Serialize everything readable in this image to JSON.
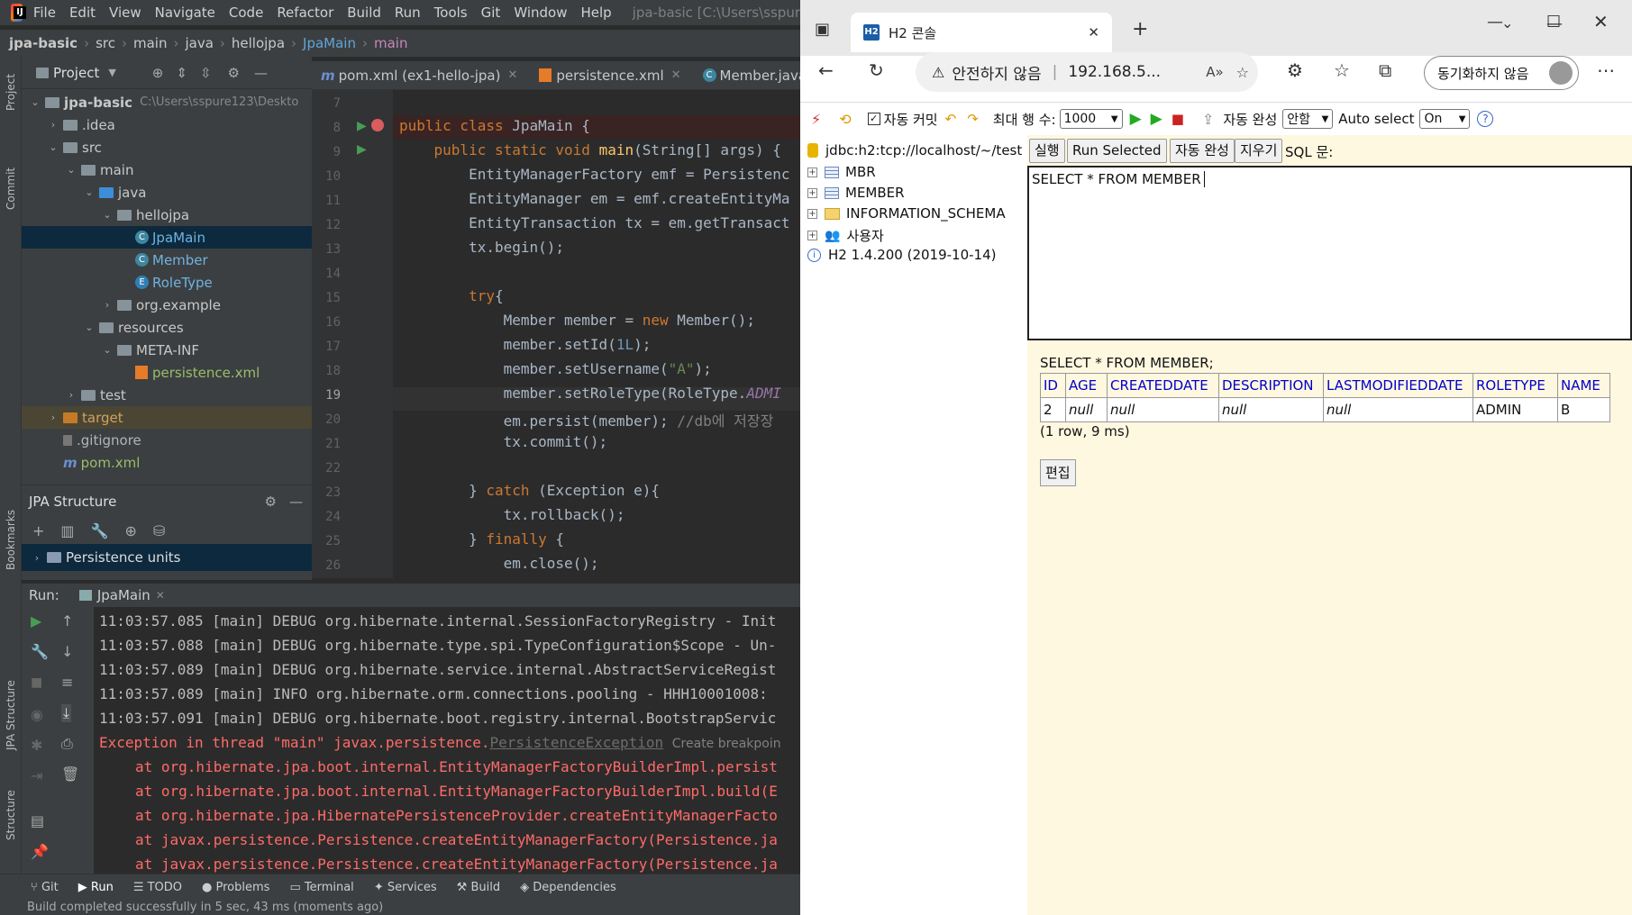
{
  "ide": {
    "menu": [
      "File",
      "Edit",
      "View",
      "Navigate",
      "Code",
      "Refactor",
      "Build",
      "Run",
      "Tools",
      "Git",
      "Window",
      "Help"
    ],
    "title": "jpa-basic [C:\\Users\\sspur",
    "breadcrumb": [
      "jpa-basic",
      "src",
      "main",
      "java",
      "hellojpa",
      "JpaMain",
      "main"
    ],
    "project_label": "Project",
    "tabs": [
      {
        "label": "pom.xml (ex1-hello-jpa)",
        "icon": "maven-icon"
      },
      {
        "label": "persistence.xml",
        "icon": "xml-icon"
      },
      {
        "label": "Member.java",
        "icon": "class-icon"
      }
    ],
    "tree": [
      {
        "label": "jpa-basic",
        "extra": "C:\\Users\\sspure123\\Deskto",
        "depth": 0,
        "arrow": "v",
        "icon": "folder"
      },
      {
        "label": ".idea",
        "depth": 1,
        "arrow": ">",
        "icon": "folder"
      },
      {
        "label": "src",
        "depth": 1,
        "arrow": "v",
        "icon": "folder"
      },
      {
        "label": "main",
        "depth": 2,
        "arrow": "v",
        "icon": "folder"
      },
      {
        "label": "java",
        "depth": 3,
        "arrow": "v",
        "icon": "folder-blue"
      },
      {
        "label": "hellojpa",
        "depth": 4,
        "arrow": "v",
        "icon": "package"
      },
      {
        "label": "JpaMain",
        "depth": 5,
        "arrow": "",
        "icon": "class",
        "selected": true
      },
      {
        "label": "Member",
        "depth": 5,
        "arrow": "",
        "icon": "class"
      },
      {
        "label": "RoleType",
        "depth": 5,
        "arrow": "",
        "icon": "enum"
      },
      {
        "label": "org.example",
        "depth": 4,
        "arrow": ">",
        "icon": "package"
      },
      {
        "label": "resources",
        "depth": 3,
        "arrow": "v",
        "icon": "folder"
      },
      {
        "label": "META-INF",
        "depth": 4,
        "arrow": "v",
        "icon": "folder"
      },
      {
        "label": "persistence.xml",
        "depth": 5,
        "arrow": "",
        "icon": "xml"
      },
      {
        "label": "test",
        "depth": 2,
        "arrow": ">",
        "icon": "folder"
      },
      {
        "label": "target",
        "depth": 1,
        "arrow": ">",
        "icon": "folder-orange",
        "highlight": true
      },
      {
        "label": ".gitignore",
        "depth": 1,
        "arrow": "",
        "icon": "git"
      },
      {
        "label": "pom.xml",
        "depth": 1,
        "arrow": "",
        "icon": "maven"
      }
    ],
    "structure_title": "JPA Structure",
    "structure_item": "Persistence units",
    "line_numbers": [
      "7",
      "8",
      "9",
      "10",
      "11",
      "12",
      "13",
      "14",
      "15",
      "16",
      "17",
      "18",
      "19",
      "20",
      "21",
      "22",
      "23",
      "24",
      "25",
      "26"
    ],
    "run_label": "Run:",
    "run_tab": "JpaMain",
    "log": [
      "11:03:57.085 [main] DEBUG org.hibernate.internal.SessionFactoryRegistry - Init",
      "11:03:57.088 [main] DEBUG org.hibernate.type.spi.TypeConfiguration$Scope - Un-",
      "11:03:57.089 [main] DEBUG org.hibernate.service.internal.AbstractServiceRegist",
      "11:03:57.089 [main] INFO org.hibernate.orm.connections.pooling - HHH10001008:",
      "11:03:57.091 [main] DEBUG org.hibernate.boot.registry.internal.BootstrapServic"
    ],
    "exception_prefix": "Exception in thread \"main\" javax.persistence.",
    "exception_link": "PersistenceException",
    "exception_hint": "Create breakpoin",
    "stack": [
      "at org.hibernate.jpa.boot.internal.EntityManagerFactoryBuilderImpl.persist",
      "at org.hibernate.jpa.boot.internal.EntityManagerFactoryBuilderImpl.build(E",
      "at org.hibernate.jpa.HibernatePersistenceProvider.createEntityManagerFacto",
      "at javax.persistence.Persistence.createEntityManagerFactory(Persistence.ja",
      "at javax.persistence.Persistence.createEntityManagerFactory(Persistence.ja"
    ],
    "bottom_tabs": [
      "Git",
      "Run",
      "TODO",
      "Problems",
      "Terminal",
      "Services",
      "Build",
      "Dependencies"
    ],
    "status": "Build completed successfully in 5 sec, 43 ms (moments ago)",
    "left_strip": [
      "Project",
      "Commit",
      "Bookmarks",
      "JPA Structure",
      "Structure"
    ]
  },
  "browser": {
    "tab_title": "H2 콘솔",
    "security": "안전하지 않음",
    "url": "192.168.5...",
    "sync_label": "동기화하지 않음"
  },
  "h2": {
    "auto_commit": "자동 커밋",
    "max_rows_label": "최대 행 수:",
    "max_rows": "1000",
    "autocomplete_label": "자동 완성",
    "autocomplete_value": "안함",
    "auto_select_label": "Auto select",
    "auto_select_value": "On",
    "connection": "jdbc:h2:tcp://localhost/~/test",
    "tree": [
      "MBR",
      "MEMBER",
      "INFORMATION_SCHEMA",
      "사용자"
    ],
    "version": "H2 1.4.200 (2019-10-14)",
    "buttons": [
      "실행",
      "Run Selected",
      "자동 완성",
      "지우기"
    ],
    "sql_label": "SQL 문:",
    "sql_text": "SELECT * FROM MEMBER",
    "result_query": "SELECT * FROM MEMBER;",
    "columns": [
      "ID",
      "AGE",
      "CREATEDDATE",
      "DESCRIPTION",
      "LASTMODIFIEDDATE",
      "ROLETYPE",
      "NAME"
    ],
    "row": [
      "2",
      "null",
      "null",
      "null",
      "null",
      "ADMIN",
      "B"
    ],
    "row_count": "(1 row, 9 ms)",
    "edit_button": "편집"
  }
}
